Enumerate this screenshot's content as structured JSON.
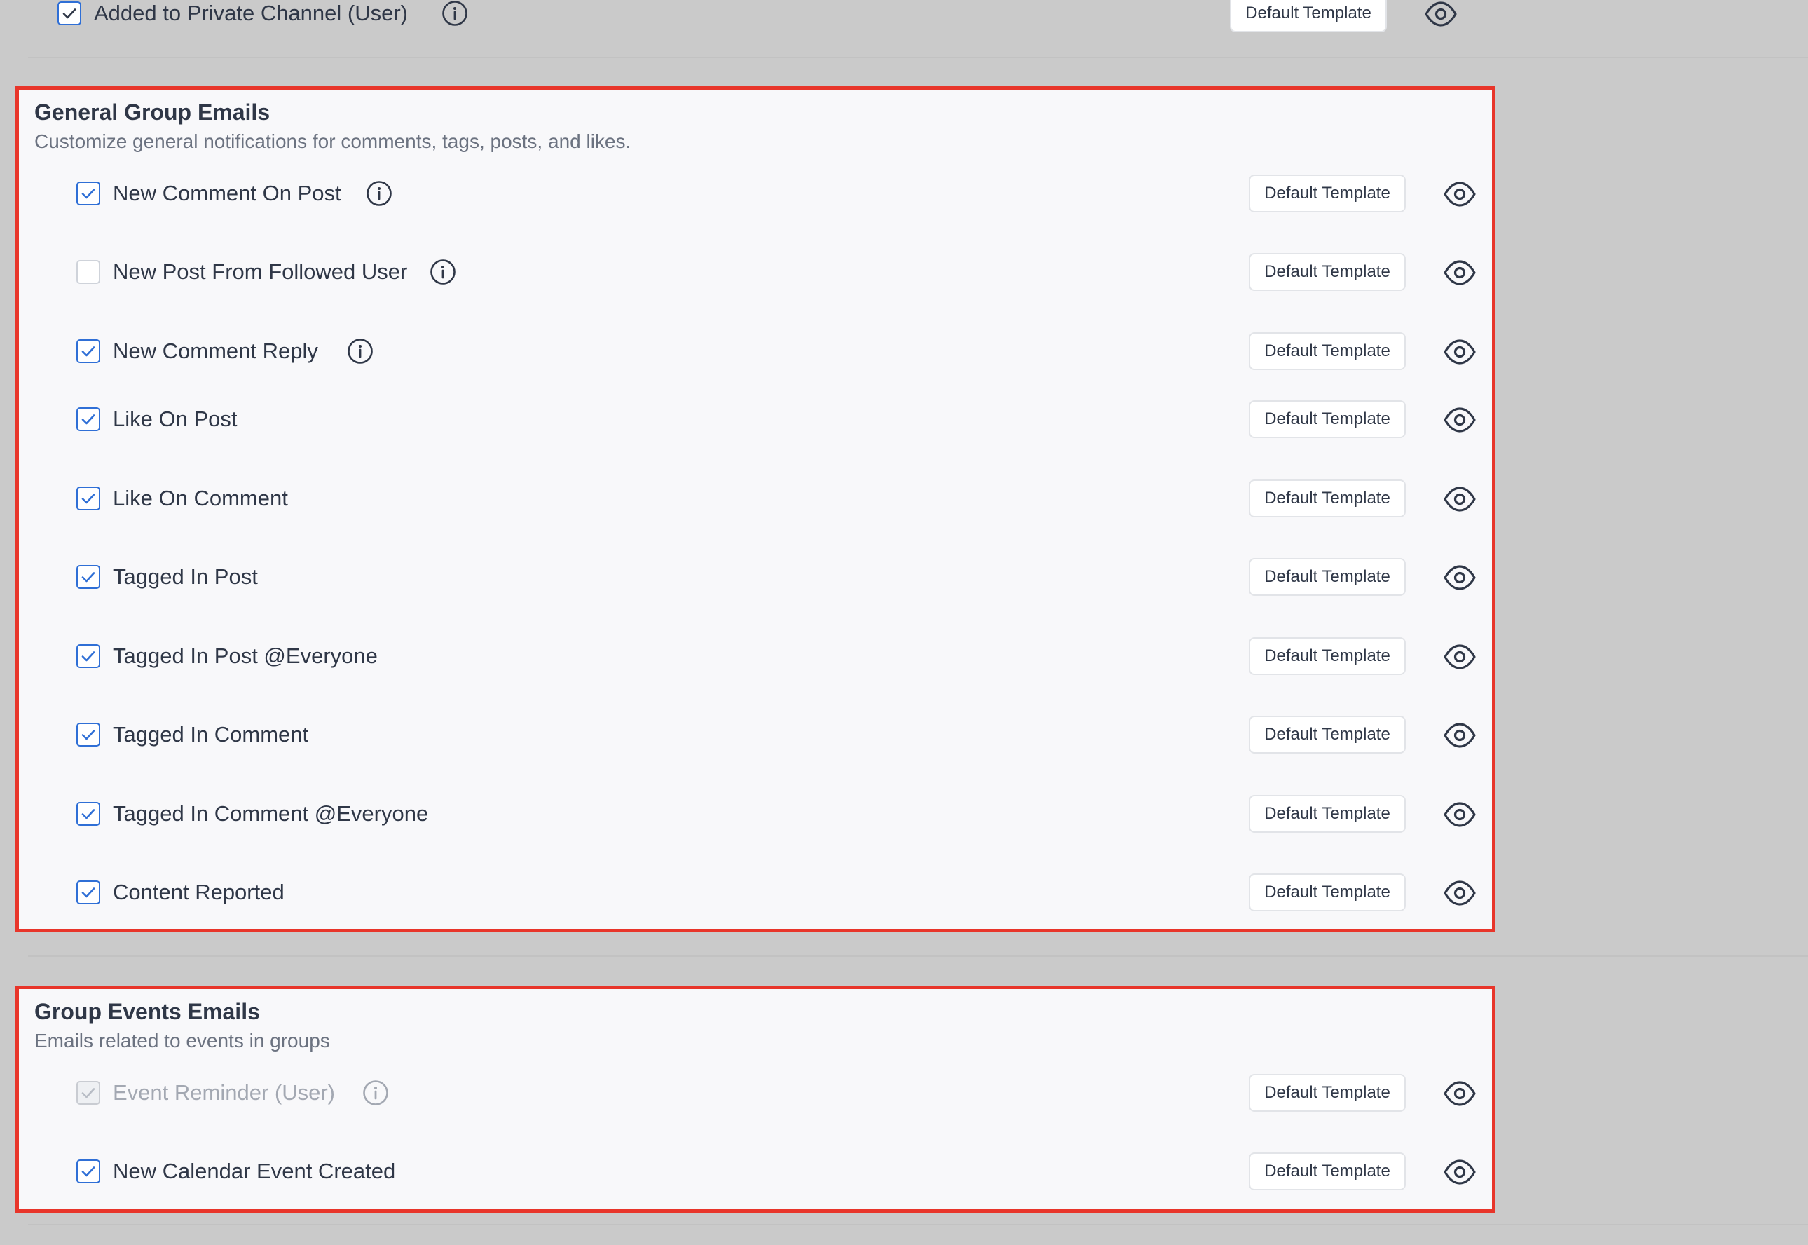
{
  "top_row": {
    "label": "Added to Private Channel (User)",
    "checked": true,
    "has_info": true,
    "template_label": "Default Template"
  },
  "sections": [
    {
      "title": "General Group Emails",
      "subtitle": "Customize general notifications for comments, tags, posts, and likes.",
      "rows": [
        {
          "label": "New Comment On Post",
          "checked": true,
          "has_info": true,
          "template_label": "Default Template"
        },
        {
          "label": "New Post From Followed User",
          "checked": false,
          "has_info": true,
          "template_label": "Default Template"
        },
        {
          "label": "New Comment Reply",
          "checked": true,
          "has_info": true,
          "template_label": "Default Template"
        },
        {
          "label": "Like On Post",
          "checked": true,
          "has_info": false,
          "template_label": "Default Template"
        },
        {
          "label": "Like On Comment",
          "checked": true,
          "has_info": false,
          "template_label": "Default Template"
        },
        {
          "label": "Tagged In Post",
          "checked": true,
          "has_info": false,
          "template_label": "Default Template"
        },
        {
          "label": "Tagged In Post @Everyone",
          "checked": true,
          "has_info": false,
          "template_label": "Default Template"
        },
        {
          "label": "Tagged In Comment",
          "checked": true,
          "has_info": false,
          "template_label": "Default Template"
        },
        {
          "label": "Tagged In Comment @Everyone",
          "checked": true,
          "has_info": false,
          "template_label": "Default Template"
        },
        {
          "label": "Content Reported",
          "checked": true,
          "has_info": false,
          "template_label": "Default Template"
        }
      ]
    },
    {
      "title": "Group Events Emails",
      "subtitle": "Emails related to events in groups",
      "rows": [
        {
          "label": "Event Reminder (User)",
          "checked": true,
          "disabled": true,
          "has_info": true,
          "template_label": "Default Template"
        },
        {
          "label": "New Calendar Event Created",
          "checked": true,
          "has_info": false,
          "template_label": "Default Template"
        }
      ]
    }
  ],
  "icons": {
    "checkbox_check": "check-icon",
    "info": "info-circle-icon",
    "preview": "eye-icon"
  },
  "colors": {
    "highlight_border": "#e8352a",
    "checkbox_blue": "#2f6fd6",
    "page_background": "#cacaca",
    "section_background": "#f8f8fa",
    "text_primary": "#2f3747",
    "text_muted": "#6b7280"
  }
}
